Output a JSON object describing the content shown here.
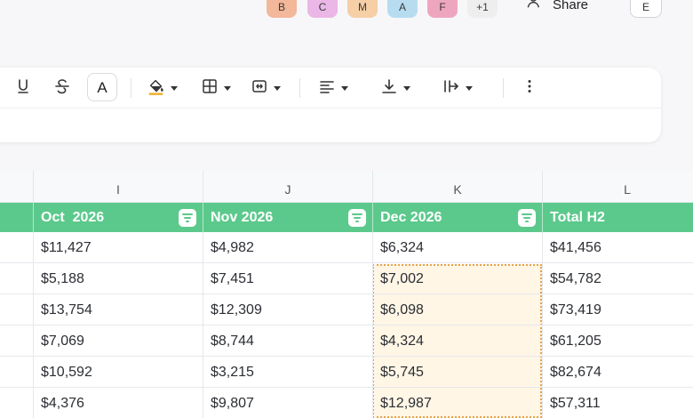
{
  "collaborators": [
    {
      "initial": "B",
      "color": "#f3b79a"
    },
    {
      "initial": "C",
      "color": "#eab7e6"
    },
    {
      "initial": "M",
      "color": "#f6cfa6"
    },
    {
      "initial": "A",
      "color": "#b7dcf0"
    },
    {
      "initial": "F",
      "color": "#eea6bf"
    },
    {
      "initial": "+1",
      "color": "#eeeeee"
    }
  ],
  "share_label": "Share",
  "user_initial": "E",
  "toolbar": {
    "underline_label": "U",
    "strike_label": "S",
    "font_color_label": "A",
    "fill_color": "#f2b53a"
  },
  "columns": [
    "I",
    "J",
    "K",
    "L"
  ],
  "headers": [
    "Oct  2026",
    "Nov 2026",
    "Dec 2026",
    "Total H2"
  ],
  "rows": [
    [
      "$11,427",
      "$4,982",
      "$6,324",
      "$41,456"
    ],
    [
      "$5,188",
      "$7,451",
      "$7,002",
      "$54,782"
    ],
    [
      "$13,754",
      "$12,309",
      "$6,098",
      "$73,419"
    ],
    [
      "$7,069",
      "$8,744",
      "$4,324",
      "$61,205"
    ],
    [
      "$10,592",
      "$3,215",
      "$5,745",
      "$82,674"
    ],
    [
      "$4,376",
      "$9,807",
      "$12,987",
      "$57,311"
    ]
  ],
  "colors": {
    "header_green": "#5cc98c",
    "selection_border": "#e6a24b",
    "selection_fill": "#fff6e6"
  }
}
